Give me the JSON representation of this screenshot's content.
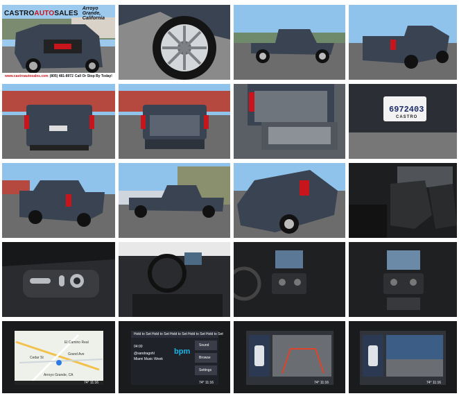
{
  "banner": {
    "brand_a": "CASTRO",
    "brand_b": "AUTO",
    "brand_c": "SALES",
    "city": "Arroyo Grande, California"
  },
  "footer": {
    "url": "www.castroautosales.com",
    "phone": "(805) 481-8972",
    "tagline": "Call Or Stop By Today!"
  },
  "plate": {
    "number": "6972403",
    "dealer": "CASTRO"
  },
  "nav_screen": {
    "street": "El Camino Real",
    "road_a": "Grand Ave",
    "road_b": "Cedar St",
    "place": "Arroyo Grande, CA",
    "temp": "74° 11:16"
  },
  "music_screen": {
    "tab_a": "Hold to Set",
    "tab_b": "Hold to Set",
    "tab_c": "Hold to Set",
    "tab_d": "Hold to Set",
    "tab_e": "Hold to Set",
    "time": "04:00",
    "track": "@sandragohl",
    "station": "Miami Music Week",
    "logo": "bpm",
    "btn_sound": "Sound",
    "btn_browse": "Browse",
    "btn_settings": "Settings",
    "temp": "74° 11:16"
  },
  "camera_screen_a": {
    "temp": "74° 11:16"
  },
  "camera_screen_b": {
    "temp": "74° 11:16"
  },
  "colors": {
    "truck_body": "#3a4352",
    "sky": "#8fc3ec",
    "asphalt": "#6c6c6c",
    "leather": "#2a2a2c",
    "accent_red": "#c8151b"
  }
}
